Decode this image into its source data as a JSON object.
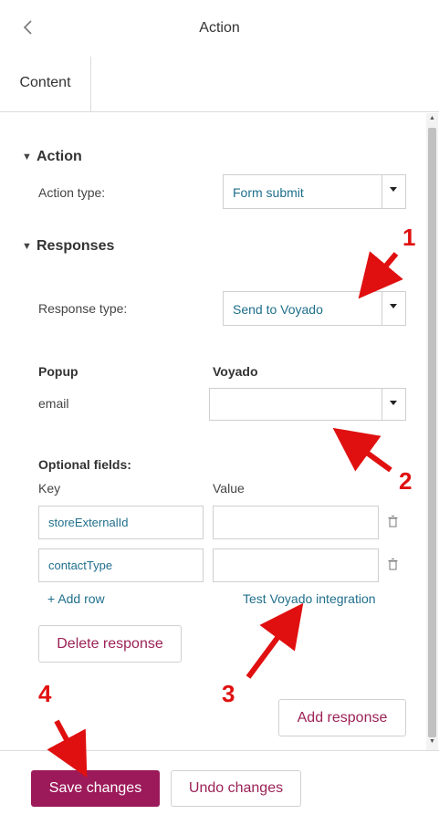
{
  "header": {
    "title": "Action",
    "back_icon": "chevron-left-icon"
  },
  "tabs": [
    {
      "label": "Content"
    }
  ],
  "action_section": {
    "heading": "Action",
    "action_type_label": "Action type:",
    "action_type_value": "Form submit"
  },
  "responses_section": {
    "heading": "Responses",
    "response_type_label": "Response type:",
    "response_type_value": "Send to Voyado",
    "mapping": {
      "col_popup": "Popup",
      "col_voyado": "Voyado",
      "row_key": "email",
      "row_value": ""
    },
    "optional": {
      "heading": "Optional fields:",
      "col_key": "Key",
      "col_value": "Value",
      "rows": [
        {
          "key": "storeExternalId",
          "value": ""
        },
        {
          "key": "contactType",
          "value": ""
        }
      ],
      "add_row": "Add row",
      "test_link": "Test Voyado integration"
    },
    "delete_response": "Delete response",
    "add_response": "Add response"
  },
  "footer": {
    "save": "Save changes",
    "undo": "Undo changes"
  },
  "annotations": [
    "1",
    "2",
    "3",
    "4"
  ],
  "colors": {
    "accent": "#9c1a5a",
    "link": "#1f6f8b",
    "annotation": "#e01010"
  }
}
